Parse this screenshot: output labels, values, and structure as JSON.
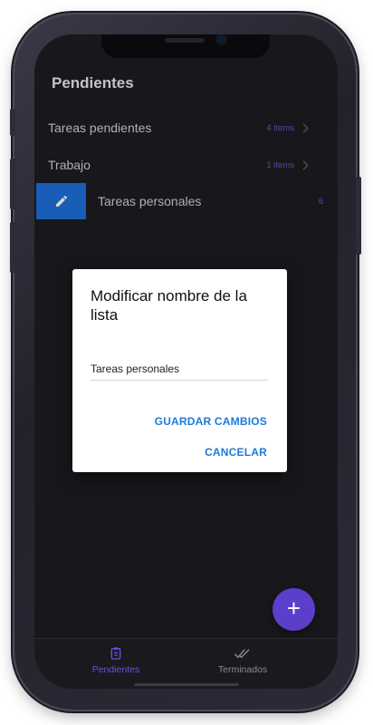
{
  "header": {
    "title": "Pendientes"
  },
  "lists": [
    {
      "label": "Tareas pendientes",
      "count": "4 items"
    },
    {
      "label": "Trabajo",
      "count": "1 items"
    },
    {
      "label": "Tareas personales",
      "count": "6"
    }
  ],
  "dialog": {
    "title": "Modificar nombre de la lista",
    "input_value": "Tareas personales",
    "save_label": "GUARDAR CAMBIOS",
    "cancel_label": "CANCELAR"
  },
  "fab": {
    "icon": "plus-icon"
  },
  "tabs": [
    {
      "label": "Pendientes",
      "icon": "clipboard-icon",
      "active": true
    },
    {
      "label": "Terminados",
      "icon": "double-check-icon",
      "active": false
    }
  ],
  "colors": {
    "accent": "#5b3ec9",
    "edit_blue": "#1d6fd6",
    "dialog_button": "#1e7bd8",
    "background": "#1d1d21"
  }
}
